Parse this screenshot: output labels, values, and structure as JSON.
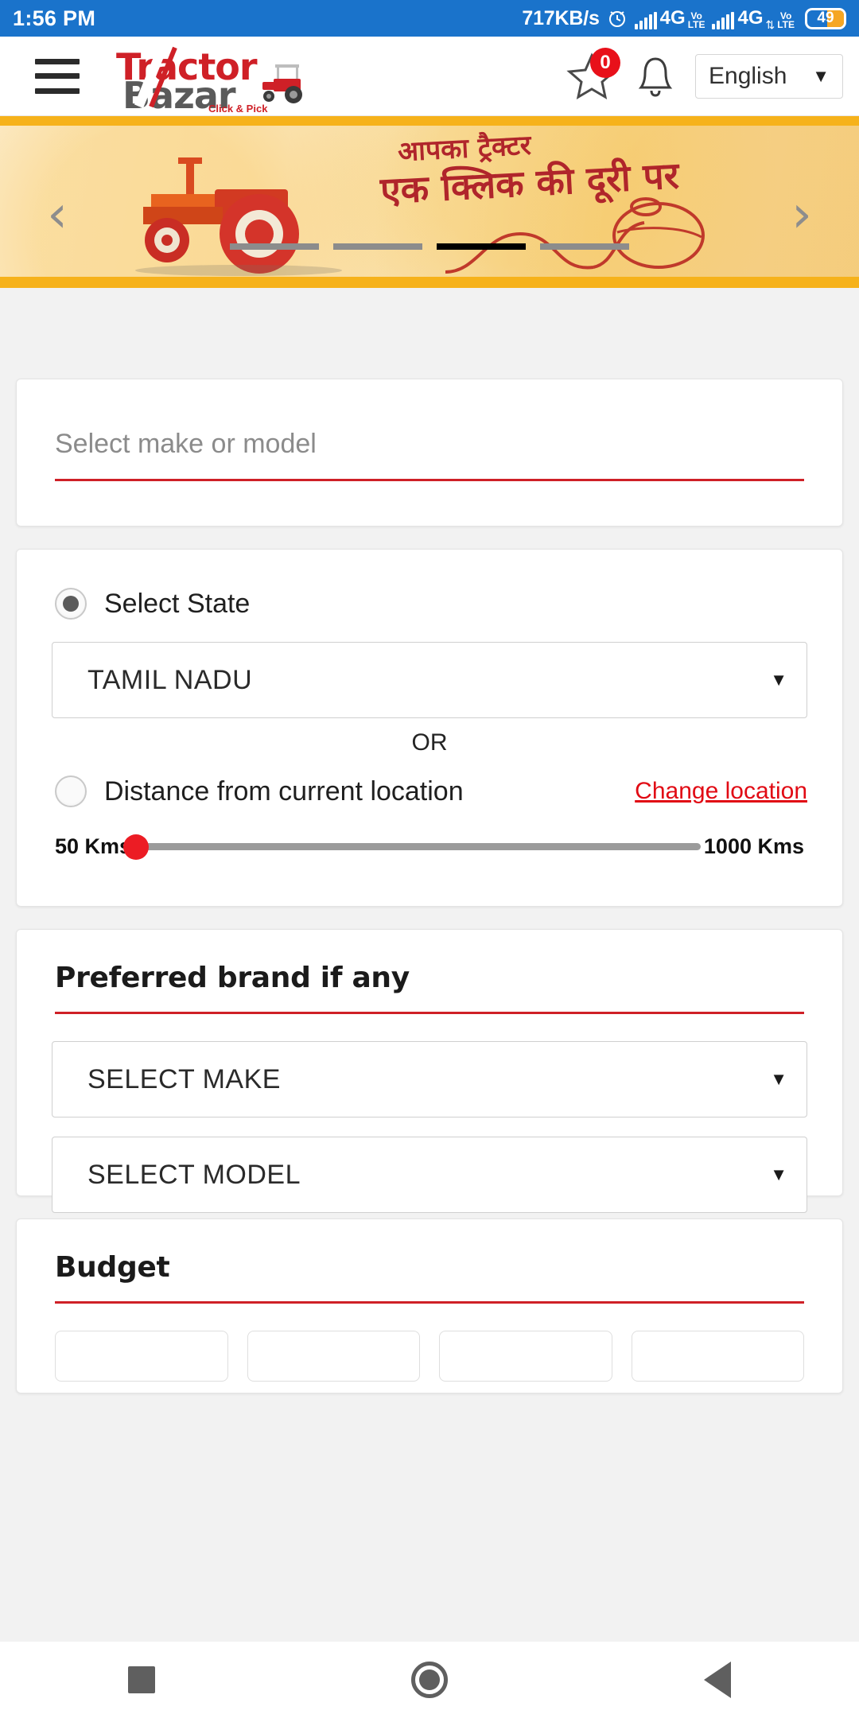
{
  "status_bar": {
    "time": "1:56 PM",
    "net_speed": "717KB/s",
    "alarm_icon": "alarm-clock-icon",
    "sim1": {
      "network": "4G",
      "volte_top": "Vo",
      "volte_bottom": "LTE"
    },
    "sim2": {
      "network": "4G",
      "data_arrows": "⇅",
      "volte_top": "Vo",
      "volte_bottom": "LTE"
    },
    "battery_level": "49",
    "bg_color": "#1a73cb",
    "battery_fill_color": "#f5a623"
  },
  "header": {
    "menu_icon": "hamburger-menu-icon",
    "logo": {
      "word1": "Tractor",
      "word2": "Bazar",
      "tagline": "Click & Pick",
      "word1_color": "#cf2027",
      "word2_color": "#5a5a5a"
    },
    "favorites": {
      "icon": "star-icon",
      "badge_count": "0",
      "badge_color": "#e8101a"
    },
    "notifications": {
      "icon": "bell-icon"
    },
    "language": {
      "value": "English",
      "caret": "▼"
    }
  },
  "banner": {
    "headline_line1": "आपका ट्रैक्टर",
    "headline_line2": "एक क्लिक की दूरी पर",
    "prev_arrow": "‹",
    "next_arrow": "›",
    "slide_count": 4,
    "active_slide": 3,
    "accent_color": "#f6b21b",
    "text_color": "#b0252b",
    "art_icon": "tractor-illustration",
    "mouse_icon": "computer-mouse-illustration"
  },
  "search": {
    "placeholder": "Select make or model",
    "underline_color": "#cf2027"
  },
  "location": {
    "state_radio": {
      "label": "Select State",
      "selected": true
    },
    "state_select": {
      "value": "TAMIL NADU",
      "caret": "▼"
    },
    "or_text": "OR",
    "distance_radio": {
      "label": "Distance from current location",
      "selected": false
    },
    "change_location_link": "Change location",
    "slider": {
      "min_label": "50 Kms",
      "max_label": "1000 Kms",
      "min": 50,
      "max": 1000,
      "value": 50,
      "thumb_color": "#ec1c24"
    }
  },
  "brand": {
    "title": "Preferred brand if any",
    "make_select": {
      "value": "SELECT MAKE",
      "caret": "▼"
    },
    "model_select": {
      "value": "SELECT MODEL",
      "caret": "▼"
    }
  },
  "budget": {
    "title": "Budget",
    "chips": [
      "",
      "",
      "",
      ""
    ]
  },
  "nav_bar": {
    "recents_icon": "square-recents-icon",
    "home_icon": "circle-home-icon",
    "back_icon": "triangle-back-icon",
    "icon_color": "#5f5f5f"
  }
}
